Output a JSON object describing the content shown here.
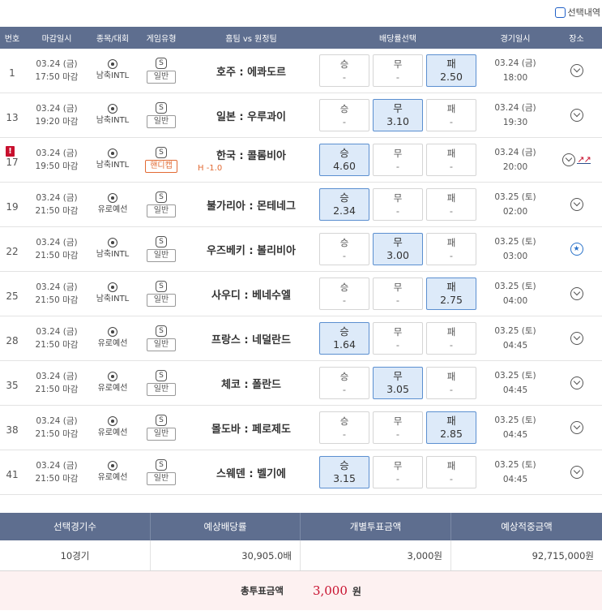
{
  "top": {
    "selection_history": "선택내역"
  },
  "columns": {
    "no": "번호",
    "deadline": "마감일시",
    "sport": "종목/대회",
    "type": "게임유형",
    "match": "홈팀 vs 원정팀",
    "odds": "배당률선택",
    "time": "경기일시",
    "place": "장소"
  },
  "rows": [
    {
      "no": "1",
      "date": "03.24 (금)",
      "deadline": "17:50 마감",
      "league": "남축INTL",
      "sport_icon": "soccer-ball-icon",
      "type_badge": "S",
      "type": "일반",
      "match": "호주 : 에콰도르",
      "odds": [
        {
          "label": "승",
          "value": "-"
        },
        {
          "label": "무",
          "value": "-"
        },
        {
          "label": "패",
          "value": "2.50"
        }
      ],
      "selected": 2,
      "game_date": "03.24 (금)",
      "game_time": "18:00",
      "place_icon": "location-pin-icon"
    },
    {
      "no": "13",
      "date": "03.24 (금)",
      "deadline": "19:20 마감",
      "league": "남축INTL",
      "sport_icon": "soccer-ball-icon",
      "type_badge": "S",
      "type": "일반",
      "match": "일본 : 우루과이",
      "odds": [
        {
          "label": "승",
          "value": "-"
        },
        {
          "label": "무",
          "value": "3.10"
        },
        {
          "label": "패",
          "value": "-"
        }
      ],
      "selected": 1,
      "game_date": "03.24 (금)",
      "game_time": "19:30",
      "place_icon": "location-pin-icon"
    },
    {
      "no": "17",
      "date": "03.24 (금)",
      "deadline": "19:50 마감",
      "league": "남축INTL",
      "sport_icon": "soccer-ball-icon",
      "type_badge": "S",
      "type": "핸디캡",
      "handicap": "H -1.0",
      "warning": "!",
      "match": "한국 : 콜롬비아",
      "odds": [
        {
          "label": "승",
          "value": "4.60"
        },
        {
          "label": "무",
          "value": "-"
        },
        {
          "label": "패",
          "value": "-"
        }
      ],
      "selected": 0,
      "game_date": "03.24 (금)",
      "game_time": "20:00",
      "place_icon": "location-pin-icon",
      "trend_icon": "trend-chart-icon"
    },
    {
      "no": "19",
      "date": "03.24 (금)",
      "deadline": "21:50 마감",
      "league": "유로예선",
      "sport_icon": "soccer-ball-icon",
      "type_badge": "S",
      "type": "일반",
      "match": "불가리아 : 몬테네그",
      "odds": [
        {
          "label": "승",
          "value": "2.34"
        },
        {
          "label": "무",
          "value": "-"
        },
        {
          "label": "패",
          "value": "-"
        }
      ],
      "selected": 0,
      "game_date": "03.25 (토)",
      "game_time": "02:00",
      "place_icon": "location-pin-icon"
    },
    {
      "no": "22",
      "date": "03.24 (금)",
      "deadline": "21:50 마감",
      "league": "남축INTL",
      "sport_icon": "soccer-ball-icon",
      "type_badge": "S",
      "type": "일반",
      "match": "우즈베키 : 볼리비아",
      "odds": [
        {
          "label": "승",
          "value": "-"
        },
        {
          "label": "무",
          "value": "3.00"
        },
        {
          "label": "패",
          "value": "-"
        }
      ],
      "selected": 1,
      "game_date": "03.25 (토)",
      "game_time": "03:00",
      "place_icon": "star-pin-icon"
    },
    {
      "no": "25",
      "date": "03.24 (금)",
      "deadline": "21:50 마감",
      "league": "남축INTL",
      "sport_icon": "soccer-ball-icon",
      "type_badge": "S",
      "type": "일반",
      "match": "사우디 : 베네수엘",
      "odds": [
        {
          "label": "승",
          "value": "-"
        },
        {
          "label": "무",
          "value": "-"
        },
        {
          "label": "패",
          "value": "2.75"
        }
      ],
      "selected": 2,
      "game_date": "03.25 (토)",
      "game_time": "04:00",
      "place_icon": "location-pin-icon"
    },
    {
      "no": "28",
      "date": "03.24 (금)",
      "deadline": "21:50 마감",
      "league": "유로예선",
      "sport_icon": "soccer-ball-icon",
      "type_badge": "S",
      "type": "일반",
      "match": "프랑스 : 네덜란드",
      "odds": [
        {
          "label": "승",
          "value": "1.64"
        },
        {
          "label": "무",
          "value": "-"
        },
        {
          "label": "패",
          "value": "-"
        }
      ],
      "selected": 0,
      "game_date": "03.25 (토)",
      "game_time": "04:45",
      "place_icon": "location-pin-icon"
    },
    {
      "no": "35",
      "date": "03.24 (금)",
      "deadline": "21:50 마감",
      "league": "유로예선",
      "sport_icon": "soccer-ball-icon",
      "type_badge": "S",
      "type": "일반",
      "match": "체코 : 폴란드",
      "odds": [
        {
          "label": "승",
          "value": "-"
        },
        {
          "label": "무",
          "value": "3.05"
        },
        {
          "label": "패",
          "value": "-"
        }
      ],
      "selected": 1,
      "game_date": "03.25 (토)",
      "game_time": "04:45",
      "place_icon": "location-pin-icon"
    },
    {
      "no": "38",
      "date": "03.24 (금)",
      "deadline": "21:50 마감",
      "league": "유로예선",
      "sport_icon": "soccer-ball-icon",
      "type_badge": "S",
      "type": "일반",
      "match": "몰도바 : 페로제도",
      "odds": [
        {
          "label": "승",
          "value": "-"
        },
        {
          "label": "무",
          "value": "-"
        },
        {
          "label": "패",
          "value": "2.85"
        }
      ],
      "selected": 2,
      "game_date": "03.25 (토)",
      "game_time": "04:45",
      "place_icon": "location-pin-icon"
    },
    {
      "no": "41",
      "date": "03.24 (금)",
      "deadline": "21:50 마감",
      "league": "유로예선",
      "sport_icon": "soccer-ball-icon",
      "type_badge": "S",
      "type": "일반",
      "match": "스웨덴 : 벨기에",
      "odds": [
        {
          "label": "승",
          "value": "3.15"
        },
        {
          "label": "무",
          "value": "-"
        },
        {
          "label": "패",
          "value": "-"
        }
      ],
      "selected": 0,
      "game_date": "03.25 (토)",
      "game_time": "04:45",
      "place_icon": "location-pin-icon"
    }
  ],
  "summary": {
    "headers": [
      "선택경기수",
      "예상배당률",
      "개별투표금액",
      "예상적중금액"
    ],
    "values": [
      "10경기",
      "30,905.0배",
      "3,000원",
      "92,715,000원"
    ],
    "total_label": "총투표금액",
    "total_value": "3,000",
    "total_unit": "원"
  },
  "colors": {
    "header_bg": "#5e6e8f",
    "selected_bg": "#ddeaf9",
    "accent_red": "#c8102e",
    "handicap_orange": "#e26b34"
  }
}
